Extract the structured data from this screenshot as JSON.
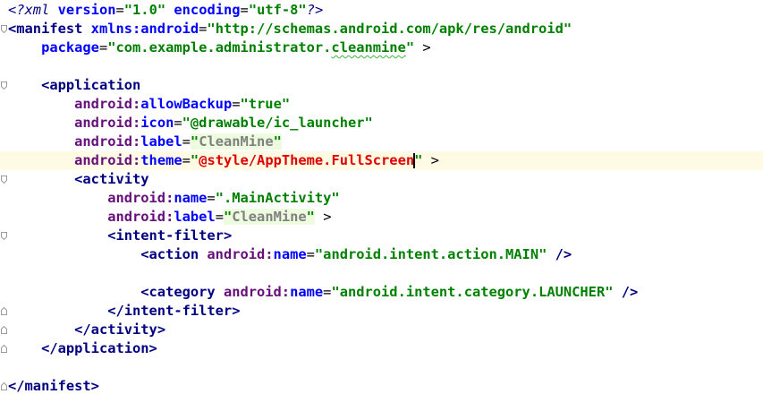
{
  "colors": {
    "tag": "#000080",
    "attribute": "#0000ff",
    "namespace": "#660e7a",
    "value": "#008000",
    "resolved_value": "#808080",
    "error_value": "#e00000",
    "current_line_bg": "#fffae3"
  },
  "icons": [
    "fold-open-icon",
    "fold-close-icon",
    "text-caret-icon"
  ],
  "lines": {
    "l1": {
      "open": "<?xml ",
      "a1": "version",
      "eq1": "=",
      "v1": "\"1.0\"",
      "sp": " ",
      "a2": "encoding",
      "eq2": "=",
      "v2": "\"utf-8\"",
      "close": "?>"
    },
    "l2": {
      "open": "<manifest ",
      "attr": "xmlns:android",
      "eq": "=",
      "val": "\"http://schemas.android.com/apk/res/android\""
    },
    "l3": {
      "indent": "    ",
      "attr": "package",
      "eq": "=",
      "val_a": "\"com.example.administrator.",
      "val_b": "cleanmine",
      "val_c": "\"",
      "close": " >"
    },
    "l5": {
      "indent": "    ",
      "open": "<application"
    },
    "l6": {
      "indent": "        ",
      "ns": "android:",
      "attr": "allowBackup",
      "eq": "=",
      "val": "\"true\""
    },
    "l7": {
      "indent": "        ",
      "ns": "android:",
      "attr": "icon",
      "eq": "=",
      "val": "\"@drawable/ic_launcher\""
    },
    "l8": {
      "indent": "        ",
      "ns": "android:",
      "attr": "label",
      "eq": "=",
      "q1": "\"",
      "val": "CleanMine",
      "q2": "\""
    },
    "l9": {
      "indent": "        ",
      "ns": "android:",
      "attr": "theme",
      "eq": "=",
      "q1": "\"",
      "val": "@style/AppTheme.FullScreen",
      "q2": "\"",
      "close": " >"
    },
    "l10": {
      "indent": "        ",
      "open": "<activity"
    },
    "l11": {
      "indent": "            ",
      "ns": "android:",
      "attr": "name",
      "eq": "=",
      "val": "\".MainActivity\""
    },
    "l12": {
      "indent": "            ",
      "ns": "android:",
      "attr": "label",
      "eq": "=",
      "q1": "\"",
      "val": "CleanMine",
      "q2": "\"",
      "close": " >"
    },
    "l13": {
      "indent": "            ",
      "open": "<intent-filter",
      "close": ">"
    },
    "l14": {
      "indent": "                ",
      "open": "<action ",
      "ns": "android:",
      "attr": "name",
      "eq": "=",
      "val": "\"android.intent.action.MAIN\"",
      "close": " />"
    },
    "l16": {
      "indent": "                ",
      "open": "<category ",
      "ns": "android:",
      "attr": "name",
      "eq": "=",
      "val": "\"android.intent.category.LAUNCHER\"",
      "close": " />"
    },
    "l17": {
      "indent": "            ",
      "open": "</intent-filter",
      "close": ">"
    },
    "l18": {
      "indent": "        ",
      "open": "</activity",
      "close": ">"
    },
    "l19": {
      "indent": "    ",
      "open": "</application",
      "close": ">"
    },
    "l21": {
      "open": "</manifest",
      "close": ">"
    }
  }
}
